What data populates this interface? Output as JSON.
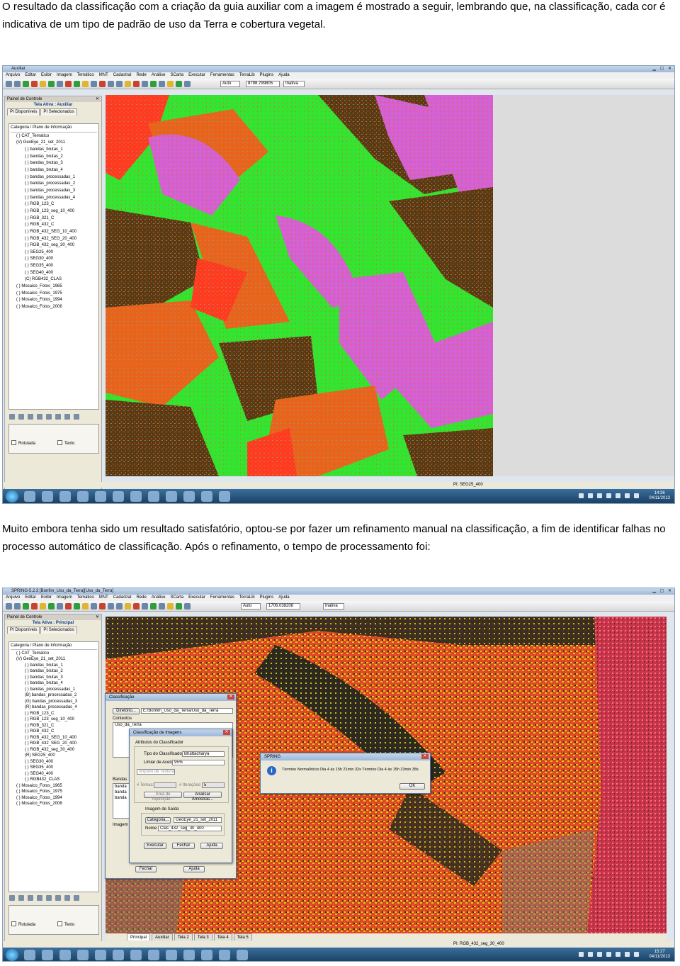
{
  "paragraphs": {
    "first": "O resultado da classificação com a criação da guia auxiliar com a imagem é mostrado a seguir, lembrando que, na classificação, cada cor é indicativa de um tipo de padrão de uso da Terra e cobertura vegetal.",
    "second": "Muito embora tenha sido um resultado satisfatório, optou-se por fazer um refinamento manual na classificação, a fim de identificar falhas no processo automático de classificação. Após o refinamento, o tempo de processamento foi:"
  },
  "menu": [
    "Arquivo",
    "Editar",
    "Exibir",
    "Imagem",
    "Temático",
    "MNT",
    "Cadastral",
    "Rede",
    "Análise",
    "SCarta",
    "Executar",
    "Ferramentas",
    "TerraLib",
    "Plugins",
    "Ajuda"
  ],
  "panel": {
    "title": "Painel de Controle",
    "tab_disponiveis": "PI Disponíveis",
    "tab_selecionados": "PI Selecionados",
    "tree_header": "Categoria / Plano de Informação",
    "rotulada": "Rotulada",
    "texto": "Texto"
  },
  "shot1": {
    "window_title": "Auxiliar",
    "tela": "Tela Ativa : Auxiliar",
    "zoom_mode": "Auto",
    "scale": "8798.799805",
    "state": "Inativa",
    "tree": [
      {
        "level": "l1",
        "text": "( ) CAT_Tematico"
      },
      {
        "level": "l1",
        "text": "(V) GeoEye_21_set_2011"
      },
      {
        "level": "l2",
        "text": "( ) bandas_brutas_1"
      },
      {
        "level": "l2",
        "text": "( ) bandas_brutas_2"
      },
      {
        "level": "l2",
        "text": "( ) bandas_brutas_3"
      },
      {
        "level": "l2",
        "text": "( ) bandas_brutas_4"
      },
      {
        "level": "l2",
        "text": "( ) bandas_processadas_1"
      },
      {
        "level": "l2",
        "text": "( ) bandas_processadas_2"
      },
      {
        "level": "l2",
        "text": "( ) bandas_processadas_3"
      },
      {
        "level": "l2",
        "text": "( ) bandas_processadas_4"
      },
      {
        "level": "l2",
        "text": "( ) RGB_123_C"
      },
      {
        "level": "l2",
        "text": "( ) RGB_123_seg_10_400"
      },
      {
        "level": "l2",
        "text": "( ) RGB_321_C"
      },
      {
        "level": "l2",
        "text": "( ) RGB_432_C"
      },
      {
        "level": "l2",
        "text": "( ) RGB_432_SEG_10_400"
      },
      {
        "level": "l2",
        "text": "( ) RGB_432_SEG_20_400"
      },
      {
        "level": "l2",
        "text": "( ) RGB_432_seg_30_400"
      },
      {
        "level": "l2",
        "text": "( ) SEG25_400"
      },
      {
        "level": "l2",
        "text": "( ) SEG30_400"
      },
      {
        "level": "l2",
        "text": "( ) SEG35_400"
      },
      {
        "level": "l2",
        "text": "( ) SEG40_400"
      },
      {
        "level": "l2",
        "text": "(C) RGB432_CLAS"
      },
      {
        "level": "l1",
        "text": "( ) Mosaico_Fotos_1965"
      },
      {
        "level": "l1",
        "text": "( ) Mosaico_Fotos_1975"
      },
      {
        "level": "l1",
        "text": "( ) Mosaico_Fotos_1994"
      },
      {
        "level": "l1",
        "text": "( ) Mosaico_Fotos_2006"
      }
    ],
    "status": "PI: SEG25_400",
    "time": "14:36",
    "date": "04/11/2013"
  },
  "shot2": {
    "window_title": "SPRING-5.2.3 [Bonfim_Uso_da_Terra][Uso_da_Terra]",
    "tela": "Tela Ativa : Principal",
    "zoom_mode": "Auto",
    "scale": "1706.038208",
    "state": "Inativa",
    "tree": [
      {
        "level": "l1",
        "text": "( ) CAT_Tematico"
      },
      {
        "level": "l1",
        "text": "(V) GeoEye_21_set_2011"
      },
      {
        "level": "l2",
        "text": "( ) bandas_brutas_1"
      },
      {
        "level": "l2",
        "text": "( ) bandas_brutas_2"
      },
      {
        "level": "l2",
        "text": "( ) bandas_brutas_3"
      },
      {
        "level": "l2",
        "text": "( ) bandas_brutas_4"
      },
      {
        "level": "l2",
        "text": "( ) bandas_processadas_1"
      },
      {
        "level": "l2",
        "text": "(B) bandas_processadas_2"
      },
      {
        "level": "l2",
        "text": "(G) bandas_processadas_3"
      },
      {
        "level": "l2",
        "text": "(R) bandas_processadas_4"
      },
      {
        "level": "l2",
        "text": "( ) RGB_123_C"
      },
      {
        "level": "l2",
        "text": "( ) RGB_123_seg_10_400"
      },
      {
        "level": "l2",
        "text": "( ) RGB_321_C"
      },
      {
        "level": "l2",
        "text": "( ) RGB_432_C"
      },
      {
        "level": "l2",
        "text": "( ) RGB_432_SEG_10_400"
      },
      {
        "level": "l2",
        "text": "( ) RGB_432_SEG_20_400"
      },
      {
        "level": "l2",
        "text": "( ) RGB_432_seg_30_400"
      },
      {
        "level": "l2",
        "text": "(R) SEG25_400"
      },
      {
        "level": "l2",
        "text": "( ) SEG30_400"
      },
      {
        "level": "l2",
        "text": "( ) SEG35_400"
      },
      {
        "level": "l2",
        "text": "( ) SEG40_400"
      },
      {
        "level": "l2",
        "text": "( ) RGB432_CLAS"
      },
      {
        "level": "l1",
        "text": "( ) Mosaico_Fotos_1965"
      },
      {
        "level": "l1",
        "text": "( ) Mosaico_Fotos_1975"
      },
      {
        "level": "l1",
        "text": "( ) Mosaico_Fotos_1994"
      },
      {
        "level": "l1",
        "text": "( ) Mosaico_Fotos_2006"
      }
    ],
    "tabs": [
      "Principal",
      "Auxiliar",
      "Tela 2",
      "Tela 3",
      "Tela 4",
      "Tela 5"
    ],
    "status": "PI: RGB_432_seg_30_400",
    "time": "15:27",
    "date": "04/11/2013",
    "dlg_class": {
      "title": "Classificação",
      "diretorio_btn": "Diretório...",
      "diretorio_value": "E:/Bonfim_Uso_da_Terra/Uso_da_Terra",
      "contextos": "Contextos",
      "contexto_item": "Uso_da_Terra",
      "bandas": "Bandas",
      "bandas_items": [
        "banda",
        "banda",
        "banda"
      ],
      "imagem": "Imagem",
      "fechar": "Fechar",
      "ajuda": "Ajuda"
    },
    "dlg_img": {
      "title": "Classificação de Imagens",
      "atributos": "Atributos do Classificador",
      "tipo_label": "Tipo do Classificador:",
      "tipo_value": "Bhattacharya",
      "limiar_label": "Limiar de Aceitação:",
      "limiar_value": "95%",
      "textura": "Arquivo de Textura...",
      "temas_label": "# Temas:",
      "iteracoes_label": "# Iterações:",
      "iteracoes_value": "5",
      "area_aquisicao": "Área de Aquisição...",
      "analisar": "Analisar Amostras...",
      "imagem_saida": "Imagem de Saída",
      "categoria_btn": "Categoria...",
      "categoria_value": "GeoEye_21_set_2011",
      "nome_label": "Nome:",
      "nome_value": "Clas_432_seg_30_400",
      "executar": "Executar",
      "fechar": "Fechar",
      "ajuda": "Ajuda"
    },
    "dlg_msg": {
      "title": "SPRING",
      "message": "Término NormalInício Dia 4 às 15h 21min 32s Término Dia 4 às 15h 23min 38s",
      "ok": "OK"
    }
  }
}
